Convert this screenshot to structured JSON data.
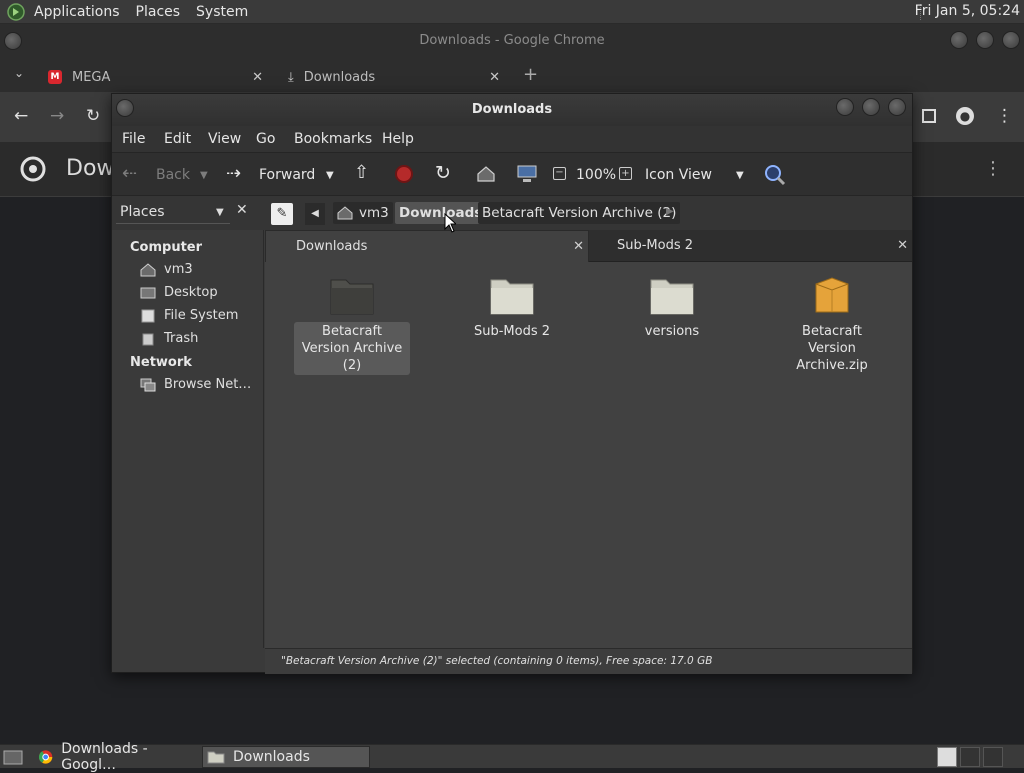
{
  "top_panel": {
    "menus": [
      "Applications",
      "Places",
      "System"
    ],
    "clock": "Fri Jan  5, 05:24"
  },
  "chrome": {
    "window_title": "Downloads - Google Chrome",
    "tabs": [
      {
        "label": "MEGA",
        "icon": "mega-icon"
      },
      {
        "label": "Downloads",
        "icon": "download-icon"
      }
    ],
    "page_title": "Dow"
  },
  "file_manager": {
    "window_title": "Downloads",
    "menus": [
      "File",
      "Edit",
      "View",
      "Go",
      "Bookmarks",
      "Help"
    ],
    "toolbar": {
      "back": "Back",
      "forward": "Forward",
      "zoom": "100%",
      "view_mode": "Icon View"
    },
    "sidebar_selector": "Places",
    "path": [
      "vm3",
      "Downloads",
      "Betacraft Version Archive (2)"
    ],
    "sidebar": {
      "computer_header": "Computer",
      "computer_items": [
        "vm3",
        "Desktop",
        "File System",
        "Trash"
      ],
      "network_header": "Network",
      "network_items": [
        "Browse Net…"
      ]
    },
    "tabs": [
      "Downloads",
      "Sub-Mods 2"
    ],
    "items": [
      {
        "name": "Betacraft Version Archive (2)",
        "type": "folder",
        "selected": true
      },
      {
        "name": "Sub-Mods 2",
        "type": "folder",
        "selected": false
      },
      {
        "name": "versions",
        "type": "folder",
        "selected": false
      },
      {
        "name": "Betacraft Version Archive.zip",
        "type": "archive",
        "selected": false
      }
    ],
    "status": "\"Betacraft Version Archive (2)\" selected (containing 0 items), Free space: 17.0 GB"
  },
  "taskbar": {
    "items": [
      "Downloads - Googl…",
      "Downloads"
    ]
  }
}
